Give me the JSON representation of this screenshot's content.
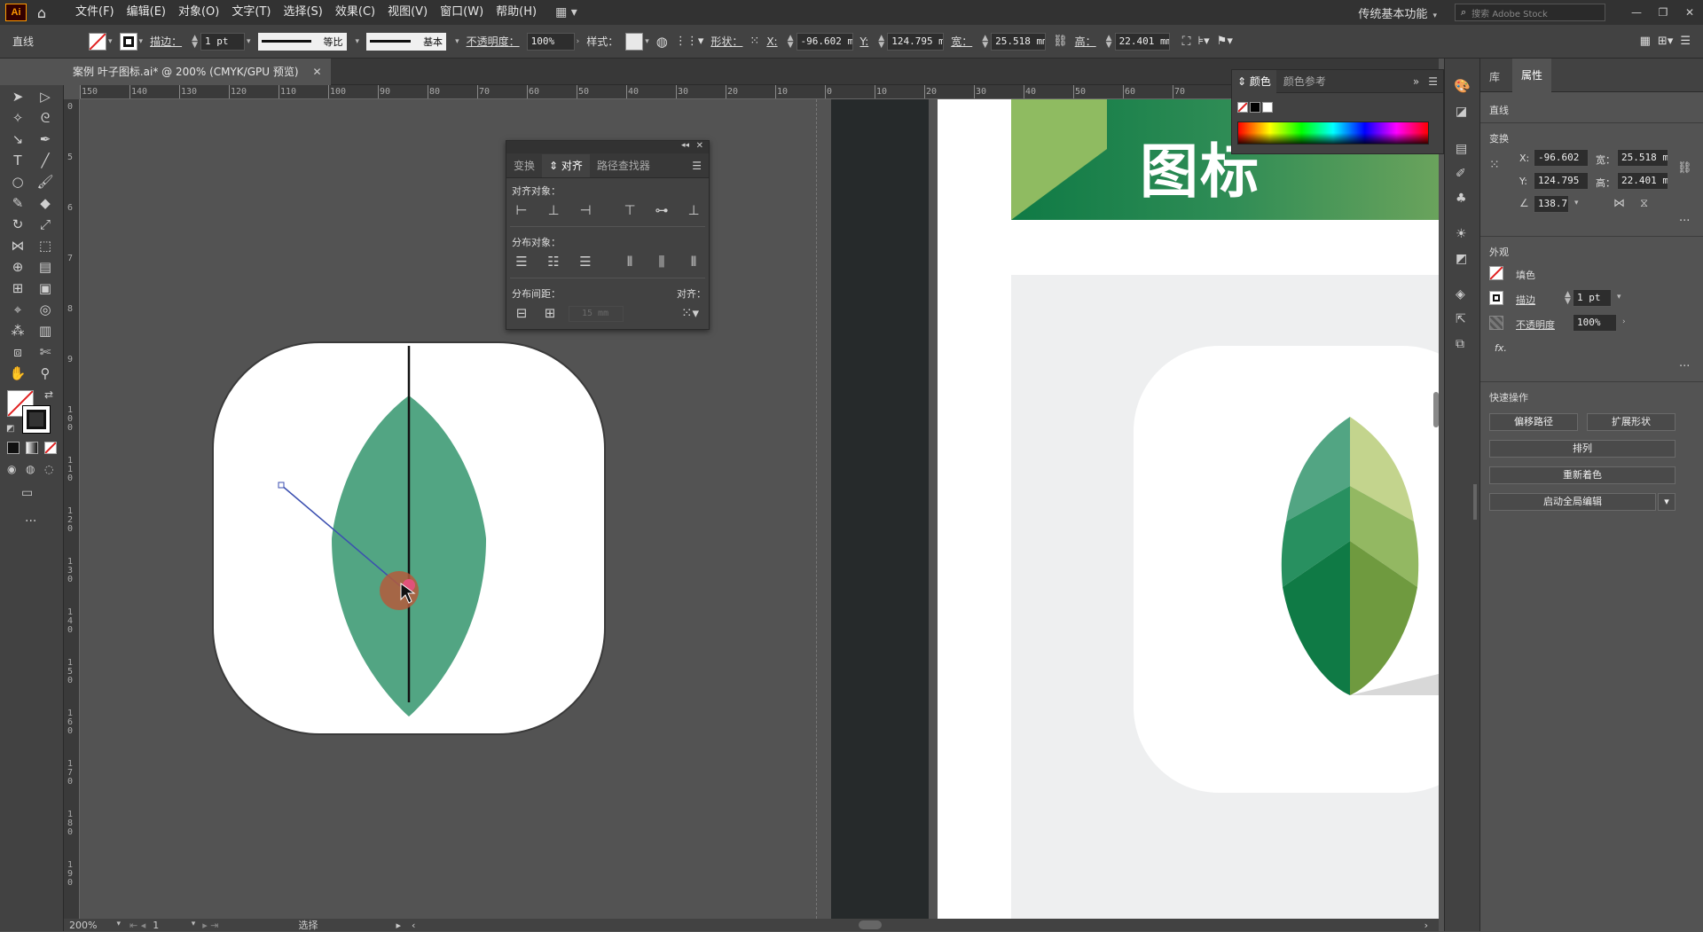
{
  "app": {
    "logo": "Ai"
  },
  "menubar": {
    "items": [
      "文件(F)",
      "编辑(E)",
      "对象(O)",
      "文字(T)",
      "选择(S)",
      "效果(C)",
      "视图(V)",
      "窗口(W)",
      "帮助(H)"
    ],
    "workspace": "传统基本功能",
    "search_placeholder": "搜索 Adobe Stock"
  },
  "control": {
    "object_type": "直线",
    "stroke_label": "描边：",
    "stroke_value": "1 pt",
    "profile_label": "等比",
    "brush_label": "基本",
    "opacity_label": "不透明度：",
    "opacity_value": "100%",
    "style_label": "样式：",
    "shape_label": "形状：",
    "x_label": "X:",
    "x_value": "-96.602 m",
    "y_label": "Y:",
    "y_value": "124.795 m",
    "w_label": "宽：",
    "w_value": "25.518 mm",
    "h_label": "高：",
    "h_value": "22.401 mm"
  },
  "document": {
    "tab_title": "案例 叶子图标.ai* @ 200% (CMYK/GPU 预览)"
  },
  "rulers": {
    "h_labels": [
      "150",
      "140",
      "130",
      "120",
      "110",
      "100",
      "90",
      "80",
      "70",
      "60",
      "50",
      "40",
      "30",
      "20",
      "10",
      "0",
      "10",
      "20",
      "30",
      "40",
      "50",
      "60",
      "70"
    ],
    "v_labels": [
      "0",
      "5",
      "6",
      "7",
      "8",
      "9",
      "1 0 0",
      "1 1 0",
      "1 2 0",
      "1 3 0",
      "1 4 0",
      "1 5 0",
      "1 6 0",
      "1 7 0",
      "1 8 0",
      "1 9 0"
    ]
  },
  "align_panel": {
    "tabs": [
      "变换",
      "对齐",
      "路径查找器"
    ],
    "align_objects": "对齐对象：",
    "distribute_objects": "分布对象：",
    "distribute_spacing": "分布间距：",
    "align_to": "对齐：",
    "spacing_value": "15 mm"
  },
  "color_panel": {
    "tabs": [
      "颜色",
      "颜色参考"
    ]
  },
  "artboard": {
    "title": "图标"
  },
  "properties": {
    "tabs": [
      "库",
      "属性"
    ],
    "object_type": "直线",
    "transform_label": "变换",
    "x_label": "X:",
    "x_value": "-96.602",
    "y_label": "Y:",
    "y_value": "124.795",
    "w_label": "宽：",
    "w_value": "25.518 m",
    "h_label": "高：",
    "h_value": "22.401 m",
    "angle_value": "138.7",
    "appearance_label": "外观",
    "fill_label": "填色",
    "stroke_label": "描边",
    "stroke_value": "1 pt",
    "opacity_label": "不透明度",
    "opacity_value": "100%",
    "fx_label": "fx.",
    "quick_actions_label": "快速操作",
    "btn_offset_path": "偏移路径",
    "btn_expand_shape": "扩展形状",
    "btn_arrange": "排列",
    "btn_recolor": "重新着色",
    "btn_global_edit": "启动全局编辑"
  },
  "status": {
    "zoom": "200%",
    "page": "1",
    "tool": "选择"
  },
  "colors": {
    "leaf_teal": "#52a583",
    "leaf_dark": "#0f7a45",
    "leaf_light": "#c3d48d",
    "banner_green": "#2e8c55"
  }
}
